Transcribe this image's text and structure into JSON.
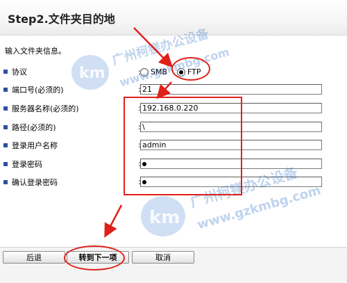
{
  "page_title": "Step2.文件夹目的地",
  "instruction": "输入文件夹信息。",
  "protocol": {
    "label": "协议",
    "options": [
      "SMB",
      "FTP"
    ],
    "selected": "FTP"
  },
  "fields": [
    {
      "label": "端口号(必须的)",
      "value": "21"
    },
    {
      "label": "服务器名称(必须的)",
      "value": "192.168.0.220"
    },
    {
      "label": "路径(必须的)",
      "value": "\\"
    },
    {
      "label": "登录用户名称",
      "value": "admin"
    },
    {
      "label": "登录密码",
      "value": ""
    },
    {
      "label": "确认登录密码",
      "value": ""
    }
  ],
  "colon": ":",
  "buttons": {
    "back": "后退",
    "next": "转到下一项",
    "cancel": "取消"
  },
  "watermark": {
    "company": "广州柯镁办公设备",
    "url": "www.gzkmbg.com"
  },
  "colors": {
    "annotation_red": "#e0201a",
    "bullet_blue": "#2d4f9e",
    "watermark_blue": "#286ec8"
  }
}
